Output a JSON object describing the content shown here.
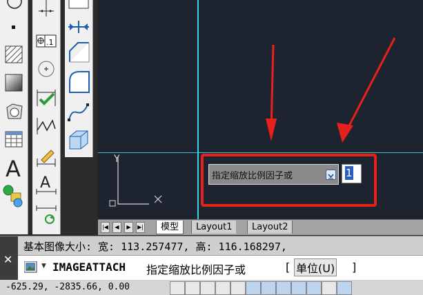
{
  "tabs": {
    "model": "模型",
    "layout1": "Layout1",
    "layout2": "Layout2"
  },
  "prompt": {
    "label": "指定缩放比例因子或",
    "input_value": "1"
  },
  "command_history": {
    "text": "基本图像大小: 宽: 113.257477, 高: 116.168297,"
  },
  "command_line": {
    "command": "IMAGEATTACH",
    "prompt_text": "指定缩放比例因子或",
    "bracket_open": "[",
    "option": "单位(U)",
    "bracket_close": "]"
  },
  "status": {
    "coordinates": "-625.29, -2835.66, 0.00"
  },
  "ucs": {
    "y_label": "Y"
  },
  "colors": {
    "canvas": "#1e2330",
    "annotation_red": "#e8201c",
    "crosshair": "#37d4e0"
  },
  "icons": [
    "hatch-icon",
    "gradient-icon",
    "region-icon",
    "table-icon",
    "multiline-text-icon",
    "point-icon",
    "insert-icon",
    "dimension-icon",
    "chamfer-icon",
    "fillet-icon",
    "spline-icon",
    "box-3d-icon",
    "close-icon",
    "image-icon"
  ]
}
